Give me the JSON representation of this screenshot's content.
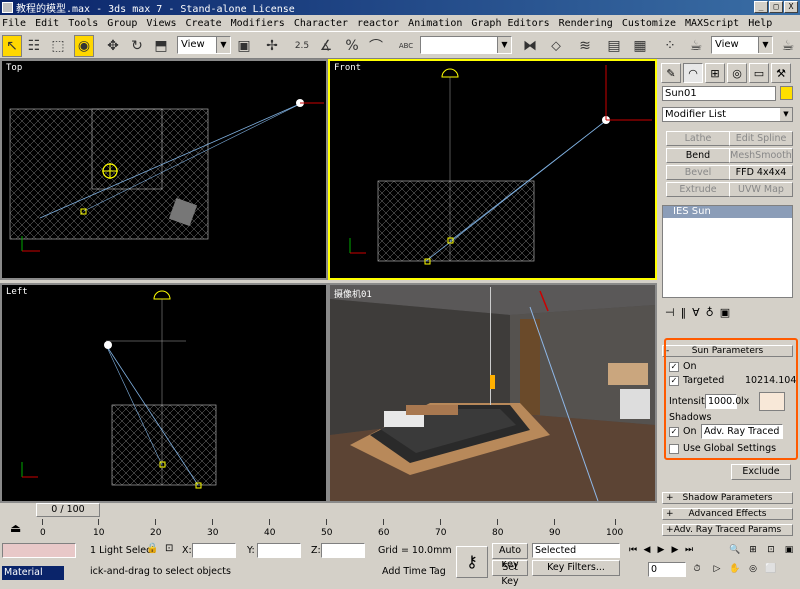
{
  "window": {
    "title": "教程的模型.max - 3ds max 7 - Stand-alone License",
    "buttons": [
      "_",
      "□",
      "X"
    ]
  },
  "menu": [
    "File",
    "Edit",
    "Tools",
    "Group",
    "Views",
    "Create",
    "Modifiers",
    "Character",
    "reactor",
    "Animation",
    "Graph Editors",
    "Rendering",
    "Customize",
    "MAXScript",
    "Help"
  ],
  "toolbar": {
    "reference_coord": "View",
    "named_selection": "",
    "render_view": "View",
    "snap_2_5": "2.5",
    "percent": "%",
    "abc": "ABC"
  },
  "viewports": {
    "top": "Top",
    "front": "Front",
    "left": "Left",
    "camera": "摄像机01"
  },
  "command_panel": {
    "object_name": "Sun01",
    "modifier_list": "Modifier List",
    "buttons": [
      {
        "label": "Lathe",
        "enabled": false
      },
      {
        "label": "Edit Spline",
        "enabled": false
      },
      {
        "label": "Bend",
        "enabled": true
      },
      {
        "label": "MeshSmooth",
        "enabled": false
      },
      {
        "label": "Bevel",
        "enabled": false
      },
      {
        "label": "FFD 4x4x4",
        "enabled": true
      },
      {
        "label": "Extrude",
        "enabled": false
      },
      {
        "label": "UVW Map",
        "enabled": false
      }
    ],
    "stack_item": "IES Sun",
    "sun_params": {
      "header": "Sun Parameters",
      "on_label": "On",
      "targeted_label": "Targeted",
      "distance": "10214.104",
      "intensity_label": "Intensity:",
      "intensity_value": "1000.0",
      "intensity_unit": "lx",
      "shadows_label": "Shadows",
      "shadow_on": "On",
      "shadow_type": "Adv. Ray Traced",
      "global_label": "Use Global Settings",
      "exclude": "Exclude"
    },
    "rollouts": [
      "Shadow Parameters",
      "Advanced Effects",
      "Adv. Ray Traced Params"
    ]
  },
  "time": {
    "frame": "0 / 100",
    "ticks": [
      "0",
      "10",
      "20",
      "30",
      "40",
      "50",
      "60",
      "70",
      "80",
      "90",
      "100"
    ]
  },
  "status": {
    "selection": "1 Light Select",
    "x_label": "X:",
    "y_label": "Y:",
    "z_label": "Z:",
    "grid": "Grid = 10.0mm",
    "prompt": "ick-and-drag to select objects",
    "add_time_tag": "Add Time Tag",
    "auto_key": "Auto Key",
    "set_key": "Set Key",
    "key_mode": "Selected",
    "key_filters": "Key Filters...",
    "frame_field": "0",
    "taskbar_item": "Material"
  },
  "colors": {
    "accent": "#ffff00",
    "highlight": "#ff5a00",
    "light_color": "#ffe000"
  }
}
